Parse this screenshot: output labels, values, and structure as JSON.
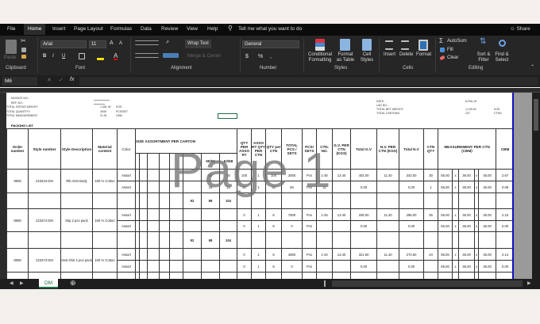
{
  "tabs": [
    "File",
    "Home",
    "Insert",
    "Page Layout",
    "Formulas",
    "Data",
    "Review",
    "View",
    "Help"
  ],
  "tell_me": "Tell me what you want to do",
  "share": "Share",
  "ribbon": {
    "clipboard": {
      "label": "Clipboard",
      "paste": "Paste"
    },
    "font": {
      "label": "Font",
      "name": "Arial",
      "size": "11",
      "bold": "B",
      "italic": "I",
      "underline": "U"
    },
    "alignment": {
      "label": "Alignment",
      "wrap": "Wrap Text",
      "merge": "Merge & Center"
    },
    "number": {
      "label": "Number",
      "format": "General",
      "currency": "$",
      "percent": "%",
      "comma": ","
    },
    "styles": {
      "label": "Styles",
      "conditional": "Conditional Formatting",
      "format_table": "Format as Table",
      "cell_styles": "Cell Styles"
    },
    "cells": {
      "label": "Cells",
      "insert": "Insert",
      "delete": "Delete",
      "format": "Format"
    },
    "editing": {
      "label": "Editing",
      "autosum": "AutoSum",
      "fill": "Fill",
      "clear": "Clear",
      "sort": "Sort & Filter",
      "find": "Find & Select"
    }
  },
  "formula_bar": {
    "name_box": "M6",
    "value": ""
  },
  "sheet": {
    "info_left": [
      "INVOICE NO.:",
      "REF. NO.:",
      "TOTAL GROSS WEIGHT:",
      "TOTAL QUANTITY:",
      "TOTAL MEASUREMENT:"
    ],
    "info_values": [
      [
        "1,461.40",
        "KGS"
      ],
      [
        "4936",
        "PCS/SET"
      ],
      [
        "21.51",
        "CBM"
      ]
    ],
    "title": "PACKING LIST",
    "info_right": [
      "DATE:",
      "LAD NO.:",
      "TOTAL NET WEIGHT:",
      "TOTAL CARTONS:"
    ],
    "info_right_values": [
      [
        "6-Feb-19",
        ""
      ],
      [
        "",
        ""
      ],
      [
        "1,199.40",
        "KGS"
      ],
      [
        "227",
        "CTNS"
      ]
    ],
    "headers": {
      "order": "Order number",
      "style": "Style number",
      "desc": "Style Description",
      "material": "Material content",
      "color": "Color",
      "size": "SIZE ASSORTMENT PER CARTON",
      "qty_asso": "QTY PER ASSO RT",
      "asso_qty": "ASSO RT QTY PER CTN",
      "qty_ctn": "QTY per CTN",
      "total": "TOTAL PCS / SETS",
      "pcs": "PCS/ SETS",
      "ctn_no": "CTN. NO.",
      "gw_per": "G.V. PER CTN (KGS)",
      "total_gw": "Total G.V",
      "nw_per": "N.V. PER CTN (KGS)",
      "total_nw": "Total N.V",
      "ctn_qty": "CTN QTY",
      "measure": "MEASUREMENT PER CTN (CBM)",
      "cbm": "CBM"
    },
    "size_labels": [
      "50/56",
      "62/68"
    ],
    "groups": [
      {
        "order": "8808",
        "style": "223344 DM",
        "desc": "Rib Vest Body",
        "material": "100 % Cotton",
        "lines": [
          [
            "Assort",
            "",
            "",
            "",
            "",
            "",
            "",
            "50",
            "50",
            "100",
            "1",
            "100",
            "3000",
            "Pcs",
            "1-30",
            "13.40",
            "402.00",
            "11.40",
            "342.00",
            "30",
            "55.00",
            "x",
            "36.00",
            "x",
            "45.00",
            "2.67"
          ],
          [
            "Assort",
            "",
            "",
            "",
            "",
            "",
            "",
            "25",
            "25",
            "50",
            "1",
            "50",
            "50",
            "Pcs",
            "31",
            "",
            "0.00",
            "",
            "0.00",
            "1",
            "55.00",
            "x",
            "36.00",
            "x",
            "45.00",
            "0.09"
          ]
        ],
        "subtotal": [
          "92",
          "98",
          "104"
        ]
      },
      {
        "order": "8808",
        "style": "223374 DM",
        "desc": "Slip 2 pce pack",
        "material": "100 % Cotton",
        "lines": [
          [
            "Assort",
            "",
            "",
            "",
            "",
            "",
            "",
            "",
            "",
            "0",
            "1",
            "6",
            "7500",
            "Pcs",
            "1-25",
            "13.40",
            "335.00",
            "11.40",
            "285.00",
            "25",
            "55.00",
            "x",
            "36.00",
            "x",
            "45.00",
            "2.23"
          ],
          [
            "Assort",
            "",
            "",
            "",
            "",
            "",
            "",
            "",
            "",
            "0",
            "1",
            "6",
            "0",
            "Pcs",
            "",
            "",
            "0.00",
            "",
            "0.00",
            "",
            "55.00",
            "x",
            "36.00",
            "x",
            "45.00",
            "0.00"
          ]
        ],
        "subtotal": [
          "92",
          "98",
          "104"
        ]
      },
      {
        "order": "8808",
        "style": "223373 DM",
        "desc": "Vest shirt 2 pce pack",
        "material": "100 % Cotton",
        "lines": [
          [
            "Assort",
            "",
            "",
            "",
            "",
            "",
            "",
            "",
            "",
            "0",
            "1",
            "6",
            "4800",
            "Pcs",
            "1-24",
            "13.40",
            "321.60",
            "11.40",
            "273.60",
            "24",
            "55.00",
            "x",
            "36.00",
            "x",
            "45.00",
            "2.14"
          ],
          [
            "Assort",
            "",
            "",
            "",
            "",
            "",
            "",
            "",
            "",
            "0",
            "1",
            "6",
            "0",
            "Pcs",
            "",
            "",
            "0.00",
            "",
            "0.00",
            "",
            "55.00",
            "x",
            "36.00",
            "x",
            "45.00",
            "0.00"
          ]
        ],
        "subtotal": [
          "92",
          "98",
          "104"
        ]
      }
    ],
    "watermark": "Page 1"
  },
  "sheet_tabs": [
    "DM"
  ]
}
